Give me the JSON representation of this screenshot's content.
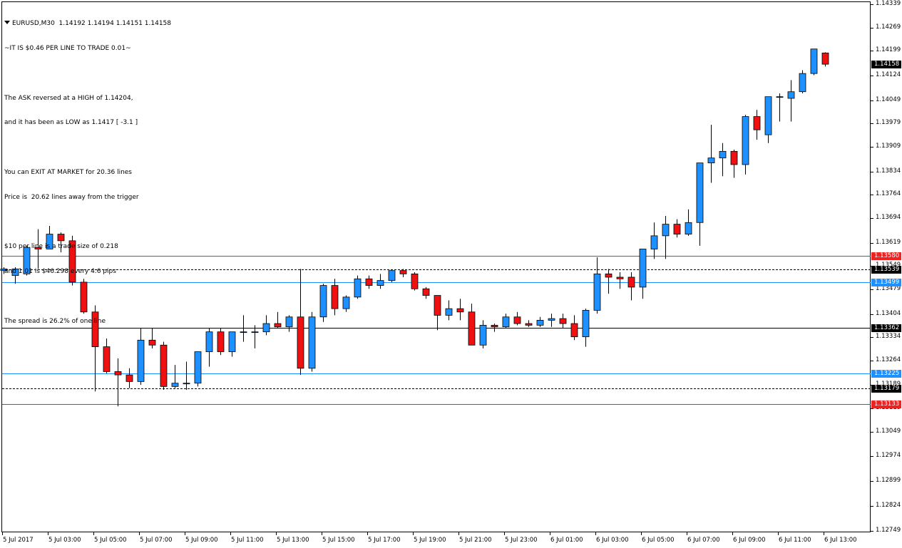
{
  "header": {
    "symbol_line": "EURUSD,M30  1.14192 1.14194 1.14151 1.14158",
    "lines": [
      "~IT IS $0.46 PER LINE TO TRADE 0.01~",
      "",
      "The ASK reversed at a HIGH of 1.14204,",
      "and it has been as LOW as 1.1417 [ -3.1 ]",
      "",
      "You can EXIT AT MARKET for 20.36 lines",
      "Price is  20.62 lines away from the trigger",
      "",
      "$10 per line is a trade size of 0.218",
      "and 1.01 is $46.298 every 4.6 pips",
      "",
      "The spread is 26.2% of one line"
    ]
  },
  "colors": {
    "bull": "#1e90ff",
    "bear": "#ee1111",
    "red_line": "#ee2222",
    "blue_line": "#1e90ff",
    "black_line": "#000000",
    "label_text_light": "#ffffff"
  },
  "price_axis": {
    "ticks": [
      "1.14339",
      "1.14269",
      "1.14199",
      "1.14124",
      "1.14049",
      "1.13979",
      "1.13909",
      "1.13834",
      "1.13764",
      "1.13694",
      "1.13619",
      "1.13549",
      "1.13479",
      "1.13404",
      "1.13334",
      "1.13264",
      "1.13189",
      "1.13119",
      "1.13049",
      "1.12974",
      "1.12899",
      "1.12824",
      "1.12749"
    ]
  },
  "price_labels": [
    {
      "text": "1.14158",
      "price": 1.14158,
      "bg": "#000000",
      "fg": "#ffffff",
      "name": "current-price-label"
    },
    {
      "text": "1.13580",
      "price": 1.1358,
      "bg": "#ee2222",
      "fg": "#ffffff",
      "name": "red-line-label-upper"
    },
    {
      "text": "1.13539",
      "price": 1.13539,
      "bg": "#000000",
      "fg": "#ffffff",
      "name": "dashed-line-label-upper"
    },
    {
      "text": "1.13499",
      "price": 1.13499,
      "bg": "#1e90ff",
      "fg": "#ffffff",
      "name": "blue-line-label-upper"
    },
    {
      "text": "1.13362",
      "price": 1.13362,
      "bg": "#000000",
      "fg": "#ffffff",
      "name": "black-line-label"
    },
    {
      "text": "1.13225",
      "price": 1.13225,
      "bg": "#1e90ff",
      "fg": "#ffffff",
      "name": "blue-line-label-lower"
    },
    {
      "text": "1.13179",
      "price": 1.13179,
      "bg": "#000000",
      "fg": "#ffffff",
      "name": "dashed-line-label-lower"
    },
    {
      "text": "1.13133",
      "price": 1.13133,
      "bg": "#ee2222",
      "fg": "#ffffff",
      "name": "red-line-label-lower"
    }
  ],
  "horizontal_lines": [
    {
      "price": 1.1358,
      "color": "#ee2222",
      "style": "solid",
      "name": "red-line-upper"
    },
    {
      "price": 1.13539,
      "color": "#000000",
      "style": "dashed",
      "name": "dashed-line-upper"
    },
    {
      "price": 1.13499,
      "color": "#1e90ff",
      "style": "solid",
      "name": "blue-line-upper"
    },
    {
      "price": 1.13362,
      "color": "#000000",
      "style": "solid",
      "name": "black-line"
    },
    {
      "price": 1.13225,
      "color": "#1e90ff",
      "style": "solid",
      "name": "blue-line-lower"
    },
    {
      "price": 1.13179,
      "color": "#000000",
      "style": "dashed",
      "name": "dashed-line-lower"
    },
    {
      "price": 1.13133,
      "color": "#ee2222",
      "style": "solid",
      "name": "red-line-lower"
    }
  ],
  "time_axis": {
    "labels": [
      "5 Jul 2017",
      "5 Jul 03:00",
      "5 Jul 05:00",
      "5 Jul 07:00",
      "5 Jul 09:00",
      "5 Jul 11:00",
      "5 Jul 13:00",
      "5 Jul 15:00",
      "5 Jul 17:00",
      "5 Jul 19:00",
      "5 Jul 21:00",
      "5 Jul 23:00",
      "6 Jul 01:00",
      "6 Jul 03:00",
      "6 Jul 05:00",
      "6 Jul 07:00",
      "6 Jul 09:00",
      "6 Jul 11:00",
      "6 Jul 13:00"
    ]
  },
  "chart_data": {
    "type": "candlestick",
    "symbol": "EURUSD",
    "timeframe": "M30",
    "ylim": [
      1.12749,
      1.14339
    ],
    "candles": [
      {
        "o": 1.13535,
        "h": 1.13545,
        "l": 1.13525,
        "c": 1.1354
      },
      {
        "o": 1.1352,
        "h": 1.13545,
        "l": 1.13495,
        "c": 1.1354
      },
      {
        "o": 1.13525,
        "h": 1.1361,
        "l": 1.1352,
        "c": 1.13605
      },
      {
        "o": 1.13605,
        "h": 1.1366,
        "l": 1.1354,
        "c": 1.136
      },
      {
        "o": 1.136,
        "h": 1.1367,
        "l": 1.136,
        "c": 1.13645
      },
      {
        "o": 1.13645,
        "h": 1.1365,
        "l": 1.1359,
        "c": 1.13625
      },
      {
        "o": 1.13625,
        "h": 1.1364,
        "l": 1.1349,
        "c": 1.135
      },
      {
        "o": 1.135,
        "h": 1.1351,
        "l": 1.13405,
        "c": 1.1341
      },
      {
        "o": 1.1341,
        "h": 1.1343,
        "l": 1.1317,
        "c": 1.13305
      },
      {
        "o": 1.13305,
        "h": 1.1333,
        "l": 1.13225,
        "c": 1.1323
      },
      {
        "o": 1.1323,
        "h": 1.1327,
        "l": 1.13125,
        "c": 1.1322
      },
      {
        "o": 1.1322,
        "h": 1.1324,
        "l": 1.1318,
        "c": 1.132
      },
      {
        "o": 1.132,
        "h": 1.1336,
        "l": 1.1319,
        "c": 1.13325
      },
      {
        "o": 1.13325,
        "h": 1.1336,
        "l": 1.133,
        "c": 1.1331
      },
      {
        "o": 1.1331,
        "h": 1.1332,
        "l": 1.13175,
        "c": 1.13185
      },
      {
        "o": 1.13185,
        "h": 1.1325,
        "l": 1.1318,
        "c": 1.13195
      },
      {
        "o": 1.13195,
        "h": 1.1326,
        "l": 1.13175,
        "c": 1.13195
      },
      {
        "o": 1.13195,
        "h": 1.1329,
        "l": 1.13185,
        "c": 1.1329
      },
      {
        "o": 1.1329,
        "h": 1.1336,
        "l": 1.13245,
        "c": 1.1335
      },
      {
        "o": 1.1335,
        "h": 1.1336,
        "l": 1.1328,
        "c": 1.1329
      },
      {
        "o": 1.1329,
        "h": 1.1335,
        "l": 1.13275,
        "c": 1.1335
      },
      {
        "o": 1.1335,
        "h": 1.134,
        "l": 1.1332,
        "c": 1.1335
      },
      {
        "o": 1.1335,
        "h": 1.1337,
        "l": 1.133,
        "c": 1.1335
      },
      {
        "o": 1.1335,
        "h": 1.134,
        "l": 1.1334,
        "c": 1.13375
      },
      {
        "o": 1.13375,
        "h": 1.1341,
        "l": 1.1336,
        "c": 1.13365
      },
      {
        "o": 1.13365,
        "h": 1.134,
        "l": 1.1335,
        "c": 1.13395
      },
      {
        "o": 1.13395,
        "h": 1.1354,
        "l": 1.1322,
        "c": 1.1324
      },
      {
        "o": 1.1324,
        "h": 1.1341,
        "l": 1.1323,
        "c": 1.13395
      },
      {
        "o": 1.13395,
        "h": 1.13495,
        "l": 1.1338,
        "c": 1.1349
      },
      {
        "o": 1.1349,
        "h": 1.1351,
        "l": 1.134,
        "c": 1.1342
      },
      {
        "o": 1.1342,
        "h": 1.1346,
        "l": 1.1341,
        "c": 1.13455
      },
      {
        "o": 1.13455,
        "h": 1.1352,
        "l": 1.1345,
        "c": 1.1351
      },
      {
        "o": 1.1351,
        "h": 1.1352,
        "l": 1.1348,
        "c": 1.1349
      },
      {
        "o": 1.1349,
        "h": 1.13525,
        "l": 1.1348,
        "c": 1.13505
      },
      {
        "o": 1.13505,
        "h": 1.13535,
        "l": 1.135,
        "c": 1.13535
      },
      {
        "o": 1.13535,
        "h": 1.1354,
        "l": 1.13515,
        "c": 1.13525
      },
      {
        "o": 1.13525,
        "h": 1.1353,
        "l": 1.13475,
        "c": 1.1348
      },
      {
        "o": 1.1348,
        "h": 1.13485,
        "l": 1.1345,
        "c": 1.1346
      },
      {
        "o": 1.1346,
        "h": 1.1346,
        "l": 1.13355,
        "c": 1.134
      },
      {
        "o": 1.134,
        "h": 1.13445,
        "l": 1.13385,
        "c": 1.1342
      },
      {
        "o": 1.1342,
        "h": 1.1345,
        "l": 1.13385,
        "c": 1.1341
      },
      {
        "o": 1.1341,
        "h": 1.13435,
        "l": 1.1331,
        "c": 1.1331
      },
      {
        "o": 1.1331,
        "h": 1.13385,
        "l": 1.133,
        "c": 1.1337
      },
      {
        "o": 1.1337,
        "h": 1.13375,
        "l": 1.1335,
        "c": 1.13365
      },
      {
        "o": 1.13365,
        "h": 1.13405,
        "l": 1.1336,
        "c": 1.13395
      },
      {
        "o": 1.13395,
        "h": 1.1341,
        "l": 1.1337,
        "c": 1.13375
      },
      {
        "o": 1.13375,
        "h": 1.13385,
        "l": 1.13365,
        "c": 1.1337
      },
      {
        "o": 1.1337,
        "h": 1.13395,
        "l": 1.13365,
        "c": 1.13385
      },
      {
        "o": 1.13385,
        "h": 1.13405,
        "l": 1.13365,
        "c": 1.1339
      },
      {
        "o": 1.1339,
        "h": 1.13405,
        "l": 1.1336,
        "c": 1.13375
      },
      {
        "o": 1.13375,
        "h": 1.134,
        "l": 1.13325,
        "c": 1.13335
      },
      {
        "o": 1.13335,
        "h": 1.1342,
        "l": 1.13305,
        "c": 1.13415
      },
      {
        "o": 1.13415,
        "h": 1.13575,
        "l": 1.13405,
        "c": 1.13525
      },
      {
        "o": 1.13525,
        "h": 1.1354,
        "l": 1.13465,
        "c": 1.13515
      },
      {
        "o": 1.13515,
        "h": 1.1353,
        "l": 1.1348,
        "c": 1.1351
      },
      {
        "o": 1.13515,
        "h": 1.1353,
        "l": 1.13445,
        "c": 1.13485
      },
      {
        "o": 1.13485,
        "h": 1.13595,
        "l": 1.1345,
        "c": 1.136
      },
      {
        "o": 1.136,
        "h": 1.1368,
        "l": 1.1357,
        "c": 1.1364
      },
      {
        "o": 1.1364,
        "h": 1.137,
        "l": 1.1357,
        "c": 1.13675
      },
      {
        "o": 1.13675,
        "h": 1.1369,
        "l": 1.13635,
        "c": 1.13645
      },
      {
        "o": 1.13645,
        "h": 1.1372,
        "l": 1.1364,
        "c": 1.1368
      },
      {
        "o": 1.1368,
        "h": 1.1386,
        "l": 1.1361,
        "c": 1.1386
      },
      {
        "o": 1.1386,
        "h": 1.13975,
        "l": 1.138,
        "c": 1.13875
      },
      {
        "o": 1.13875,
        "h": 1.1392,
        "l": 1.1382,
        "c": 1.13895
      },
      {
        "o": 1.13895,
        "h": 1.139,
        "l": 1.13815,
        "c": 1.13855
      },
      {
        "o": 1.13855,
        "h": 1.14005,
        "l": 1.13825,
        "c": 1.14
      },
      {
        "o": 1.14,
        "h": 1.1402,
        "l": 1.1393,
        "c": 1.1396
      },
      {
        "o": 1.13945,
        "h": 1.14055,
        "l": 1.1392,
        "c": 1.1406
      },
      {
        "o": 1.1406,
        "h": 1.1407,
        "l": 1.13985,
        "c": 1.1406
      },
      {
        "o": 1.14055,
        "h": 1.1411,
        "l": 1.13985,
        "c": 1.14075
      },
      {
        "o": 1.14075,
        "h": 1.1414,
        "l": 1.1407,
        "c": 1.1413
      },
      {
        "o": 1.1413,
        "h": 1.14204,
        "l": 1.14125,
        "c": 1.14204
      },
      {
        "o": 1.14192,
        "h": 1.14194,
        "l": 1.14151,
        "c": 1.14158
      }
    ]
  }
}
